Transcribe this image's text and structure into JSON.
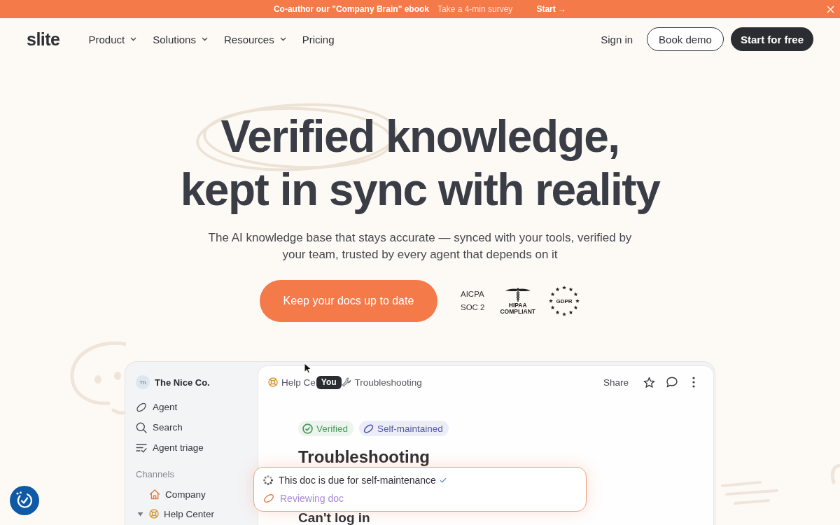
{
  "banner": {
    "headline": "Co-author our \"Company Brain\" ebook",
    "text": "Take a 4-min survey",
    "link": "Start →"
  },
  "nav": {
    "logo": "slite",
    "items": [
      {
        "label": "Product",
        "has_menu": true
      },
      {
        "label": "Solutions",
        "has_menu": true
      },
      {
        "label": "Resources",
        "has_menu": true
      },
      {
        "label": "Pricing",
        "has_menu": false
      }
    ],
    "sign_in": "Sign in",
    "buttons": [
      {
        "kind": "outline",
        "label": "Book demo"
      },
      {
        "kind": "solid",
        "label": "Start for free"
      }
    ]
  },
  "hero": {
    "title_lines": [
      "Verified knowledge,",
      "kept in sync with reality"
    ],
    "subtitle": "The AI knowledge base that stays accurate — synced with your tools, verified by your team, trusted by every agent that depends on it",
    "cta": "Keep your docs up to date",
    "certifications": [
      {
        "kind": "aicpa",
        "lines": [
          "AICPA",
          "SOC 2"
        ]
      },
      {
        "kind": "hipaa",
        "lines": [
          "HIPAA",
          "COMPLIANT"
        ]
      },
      {
        "kind": "gdpr",
        "lines": [
          "GDPR"
        ]
      }
    ]
  },
  "app": {
    "sidebar": {
      "workspace": {
        "initials": "Th",
        "name": "The Nice Co."
      },
      "items": [
        {
          "kind": "agent",
          "label": "Agent"
        },
        {
          "kind": "search",
          "label": "Search"
        },
        {
          "kind": "triage",
          "label": "Agent triage"
        }
      ],
      "section": "Channels",
      "channels": [
        {
          "kind": "home",
          "label": "Company"
        },
        {
          "kind": "lifebuoy",
          "label": "Help Center",
          "expanded": true
        }
      ]
    },
    "doc": {
      "breadcrumb": [
        {
          "kind": "lifebuoy",
          "label": "Help Ce"
        },
        {
          "kind": "wrench",
          "label": "Troubleshooting"
        }
      ],
      "presence": "You",
      "share": "Share",
      "tags": [
        {
          "kind": "verified",
          "label": "Verified",
          "color": "#4e9a5c"
        },
        {
          "kind": "maintained",
          "label": "Self-maintained",
          "color": "#5358ad"
        }
      ],
      "title": "Troubleshooting",
      "subheading": "Can't log in"
    },
    "popup": {
      "rows": [
        {
          "kind": "task",
          "text": "This doc is due for self-maintenance",
          "done": true
        },
        {
          "kind": "status",
          "text": "Reviewing doc",
          "done": false
        }
      ]
    }
  }
}
